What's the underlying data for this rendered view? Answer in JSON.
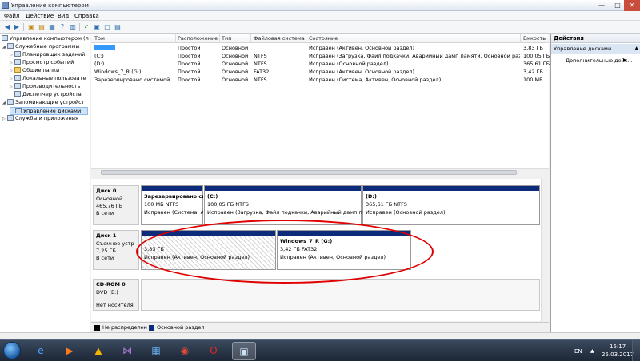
{
  "window": {
    "title": "Управление компьютером",
    "min_glyph": "—",
    "max_glyph": "□",
    "close_glyph": "✕"
  },
  "menu": [
    "Файл",
    "Действие",
    "Вид",
    "Справка"
  ],
  "tree": [
    {
      "label": "Управление компьютером (л",
      "level": 0,
      "arrow": ""
    },
    {
      "label": "Служебные программы",
      "level": 1,
      "arrow": "◢"
    },
    {
      "label": "Планировщик заданий",
      "level": 2,
      "arrow": "▷"
    },
    {
      "label": "Просмотр событий",
      "level": 2,
      "arrow": "▷"
    },
    {
      "label": "Общие папки",
      "level": 2,
      "arrow": "▷"
    },
    {
      "label": "Локальные пользовате",
      "level": 2,
      "arrow": "▷"
    },
    {
      "label": "Производительность",
      "level": 2,
      "arrow": "▷"
    },
    {
      "label": "Диспетчер устройств",
      "level": 2,
      "arrow": ""
    },
    {
      "label": "Запоминающие устройст",
      "level": 1,
      "arrow": "◢"
    },
    {
      "label": "Управление дисками",
      "level": 2,
      "arrow": "",
      "selected": true
    },
    {
      "label": "Службы и приложения",
      "level": 1,
      "arrow": "▷"
    }
  ],
  "table": {
    "headers": [
      "Том",
      "Расположение",
      "Тип",
      "Файловая система",
      "Состояние",
      "Емкость"
    ],
    "rows": [
      {
        "vol": "",
        "loc": "Простой",
        "type": "Основной",
        "fs": "",
        "status": "Исправен (Активен, Основной раздел)",
        "cap": "3,83 ГБ",
        "highlight": true
      },
      {
        "vol": "(C:)",
        "loc": "Простой",
        "type": "Основной",
        "fs": "NTFS",
        "status": "Исправен (Загрузка, Файл подкачки, Аварийный дамп памяти, Основной раздел)",
        "cap": "100,05 ГБ"
      },
      {
        "vol": "(D:)",
        "loc": "Простой",
        "type": "Основной",
        "fs": "NTFS",
        "status": "Исправен (Основной раздел)",
        "cap": "365,61 ГБ"
      },
      {
        "vol": "Windows_7_R (G:)",
        "loc": "Простой",
        "type": "Основной",
        "fs": "FAT32",
        "status": "Исправен (Активен, Основной раздел)",
        "cap": "3,42 ГБ"
      },
      {
        "vol": "Зарезервировано системой",
        "loc": "Простой",
        "type": "Основной",
        "fs": "NTFS",
        "status": "Исправен (Система, Активен, Основной раздел)",
        "cap": "100 МБ"
      }
    ]
  },
  "disks": [
    {
      "name": "Диск 0",
      "kind": "Основной",
      "size": "465,76 ГБ",
      "state": "В сети",
      "partitions": [
        {
          "title": "Зарезервировано си",
          "size": "100 МБ NTFS",
          "status": "Исправен (Система, А"
        },
        {
          "title": "(C:)",
          "size": "100,05 ГБ NTFS",
          "status": "Исправен (Загрузка, Файл подкачки, Аварийный дамп п"
        },
        {
          "title": "(D:)",
          "size": "365,61 ГБ NTFS",
          "status": "Исправен (Основной раздел)"
        }
      ]
    },
    {
      "name": "Диск 1",
      "kind": "Съемное устр",
      "size": "7,25 ГБ",
      "state": "В сети",
      "partitions": [
        {
          "title": "",
          "size": "3,83 ГБ",
          "status": "Исправен (Активен, Основной раздел)"
        },
        {
          "title": "Windows_7_R  (G:)",
          "size": "3,42 ГБ FAT32",
          "status": "Исправен (Активен, Основной раздел)"
        }
      ]
    },
    {
      "name": "CD-ROM 0",
      "kind": "DVD (E:)",
      "size": "",
      "state": "Нет носителя"
    }
  ],
  "legend": [
    {
      "label": "Не распределен",
      "color": "#000000"
    },
    {
      "label": "Основной раздел",
      "color": "#0c2b7a"
    }
  ],
  "actions": {
    "header": "Действия",
    "section": "Управление дисками",
    "item": "Дополнительные дейс..."
  },
  "taskbar": {
    "lang": "EN",
    "time": "15:17",
    "date": "25.03.2017"
  },
  "colors": {
    "accent": "#3399ff",
    "annotation": "#e00000",
    "partition_bar": "#0c2b7a"
  }
}
